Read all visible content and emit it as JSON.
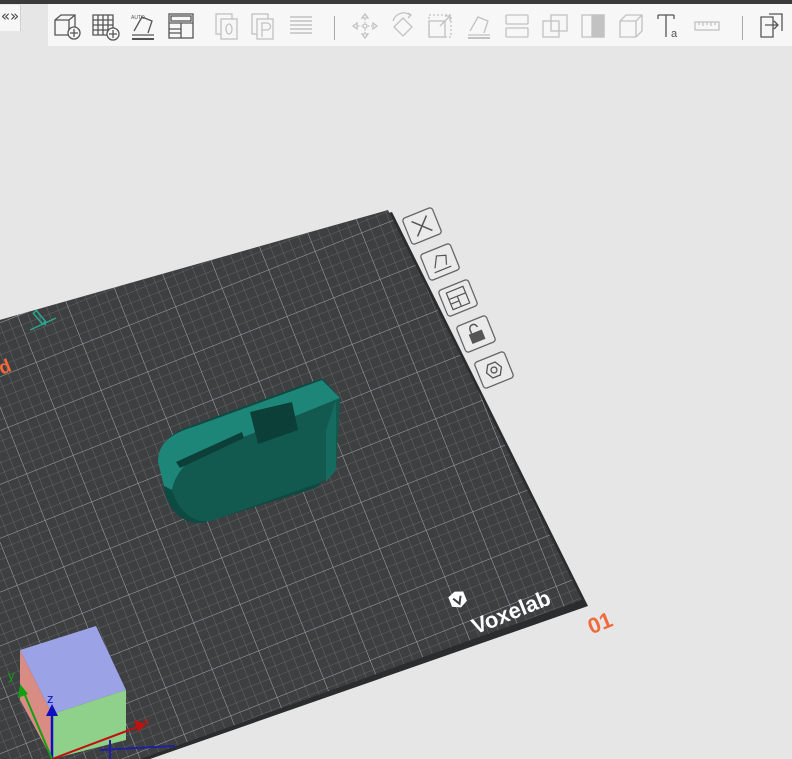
{
  "toolbar": {
    "collapse_glyph": "«»",
    "icons": [
      "add-object-icon",
      "add-grid-icon",
      "auto-arrange-icon",
      "layout-icon",
      "copy-icon",
      "paste-icon",
      "menu-lines-icon",
      "move-icon",
      "rotate-icon",
      "scale-icon",
      "lay-flat-icon",
      "split-icon",
      "merge-icon",
      "cut-icon",
      "support-icon",
      "text-icon",
      "measure-icon",
      "export-icon"
    ]
  },
  "plate": {
    "label_partial": "ed",
    "brand": "Voxelab",
    "number": "01",
    "side_buttons": [
      "close-plate-icon",
      "auto-arrange-plate-icon",
      "plate-settings-icon",
      "lock-plate-icon",
      "nut-settings-icon"
    ]
  },
  "gizmo": {
    "x_label": "x",
    "y_label": "y",
    "z_label": "z"
  },
  "colors": {
    "accent": "#f06a3c",
    "plate": "#3d3f40",
    "model": "#1d8678"
  }
}
